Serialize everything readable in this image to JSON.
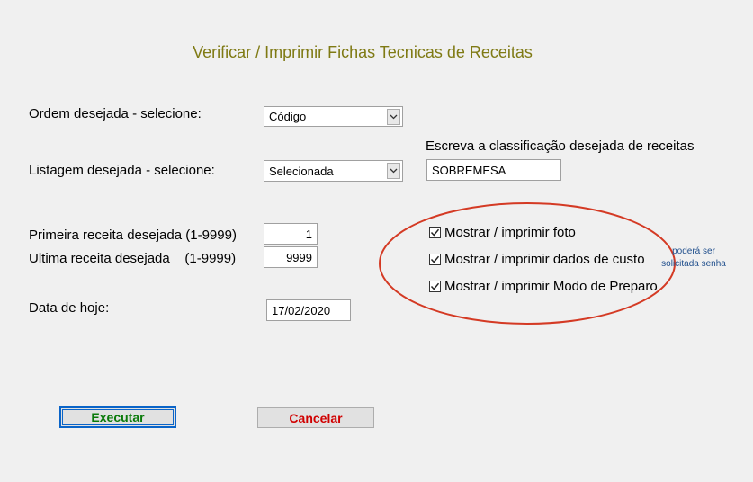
{
  "title": "Verificar / Imprimir Fichas Tecnicas de Receitas",
  "order": {
    "label": "Ordem desejada - selecione:",
    "value": "Código"
  },
  "listing": {
    "label": "Listagem desejada - selecione:",
    "value": "Selecionada"
  },
  "classification": {
    "label": "Escreva a classificação desejada de receitas",
    "value": "SOBREMESA"
  },
  "first": {
    "label": "Primeira receita desejada  (1-9999)",
    "value": "1"
  },
  "last": {
    "label": "Ultima receita desejada    (1-9999)",
    "value": "9999"
  },
  "date": {
    "label": "Data de hoje:",
    "value": "17/02/2020"
  },
  "options": [
    {
      "label": "Mostrar / imprimir foto",
      "checked": true
    },
    {
      "label": "Mostrar / imprimir dados de custo",
      "checked": true
    },
    {
      "label": "Mostrar / imprimir Modo de Preparo",
      "checked": true
    }
  ],
  "note": {
    "line1": "poderá ser",
    "line2": "solicitada senha"
  },
  "buttons": {
    "execute": "Executar",
    "cancel": "Cancelar"
  },
  "colors": {
    "title": "#7f7a14",
    "execute": "#0a7a0a",
    "cancel": "#d00000",
    "circle": "#d43a24"
  },
  "icons": {
    "dropdown": "chevron-down-icon",
    "check": "checkmark-icon"
  }
}
